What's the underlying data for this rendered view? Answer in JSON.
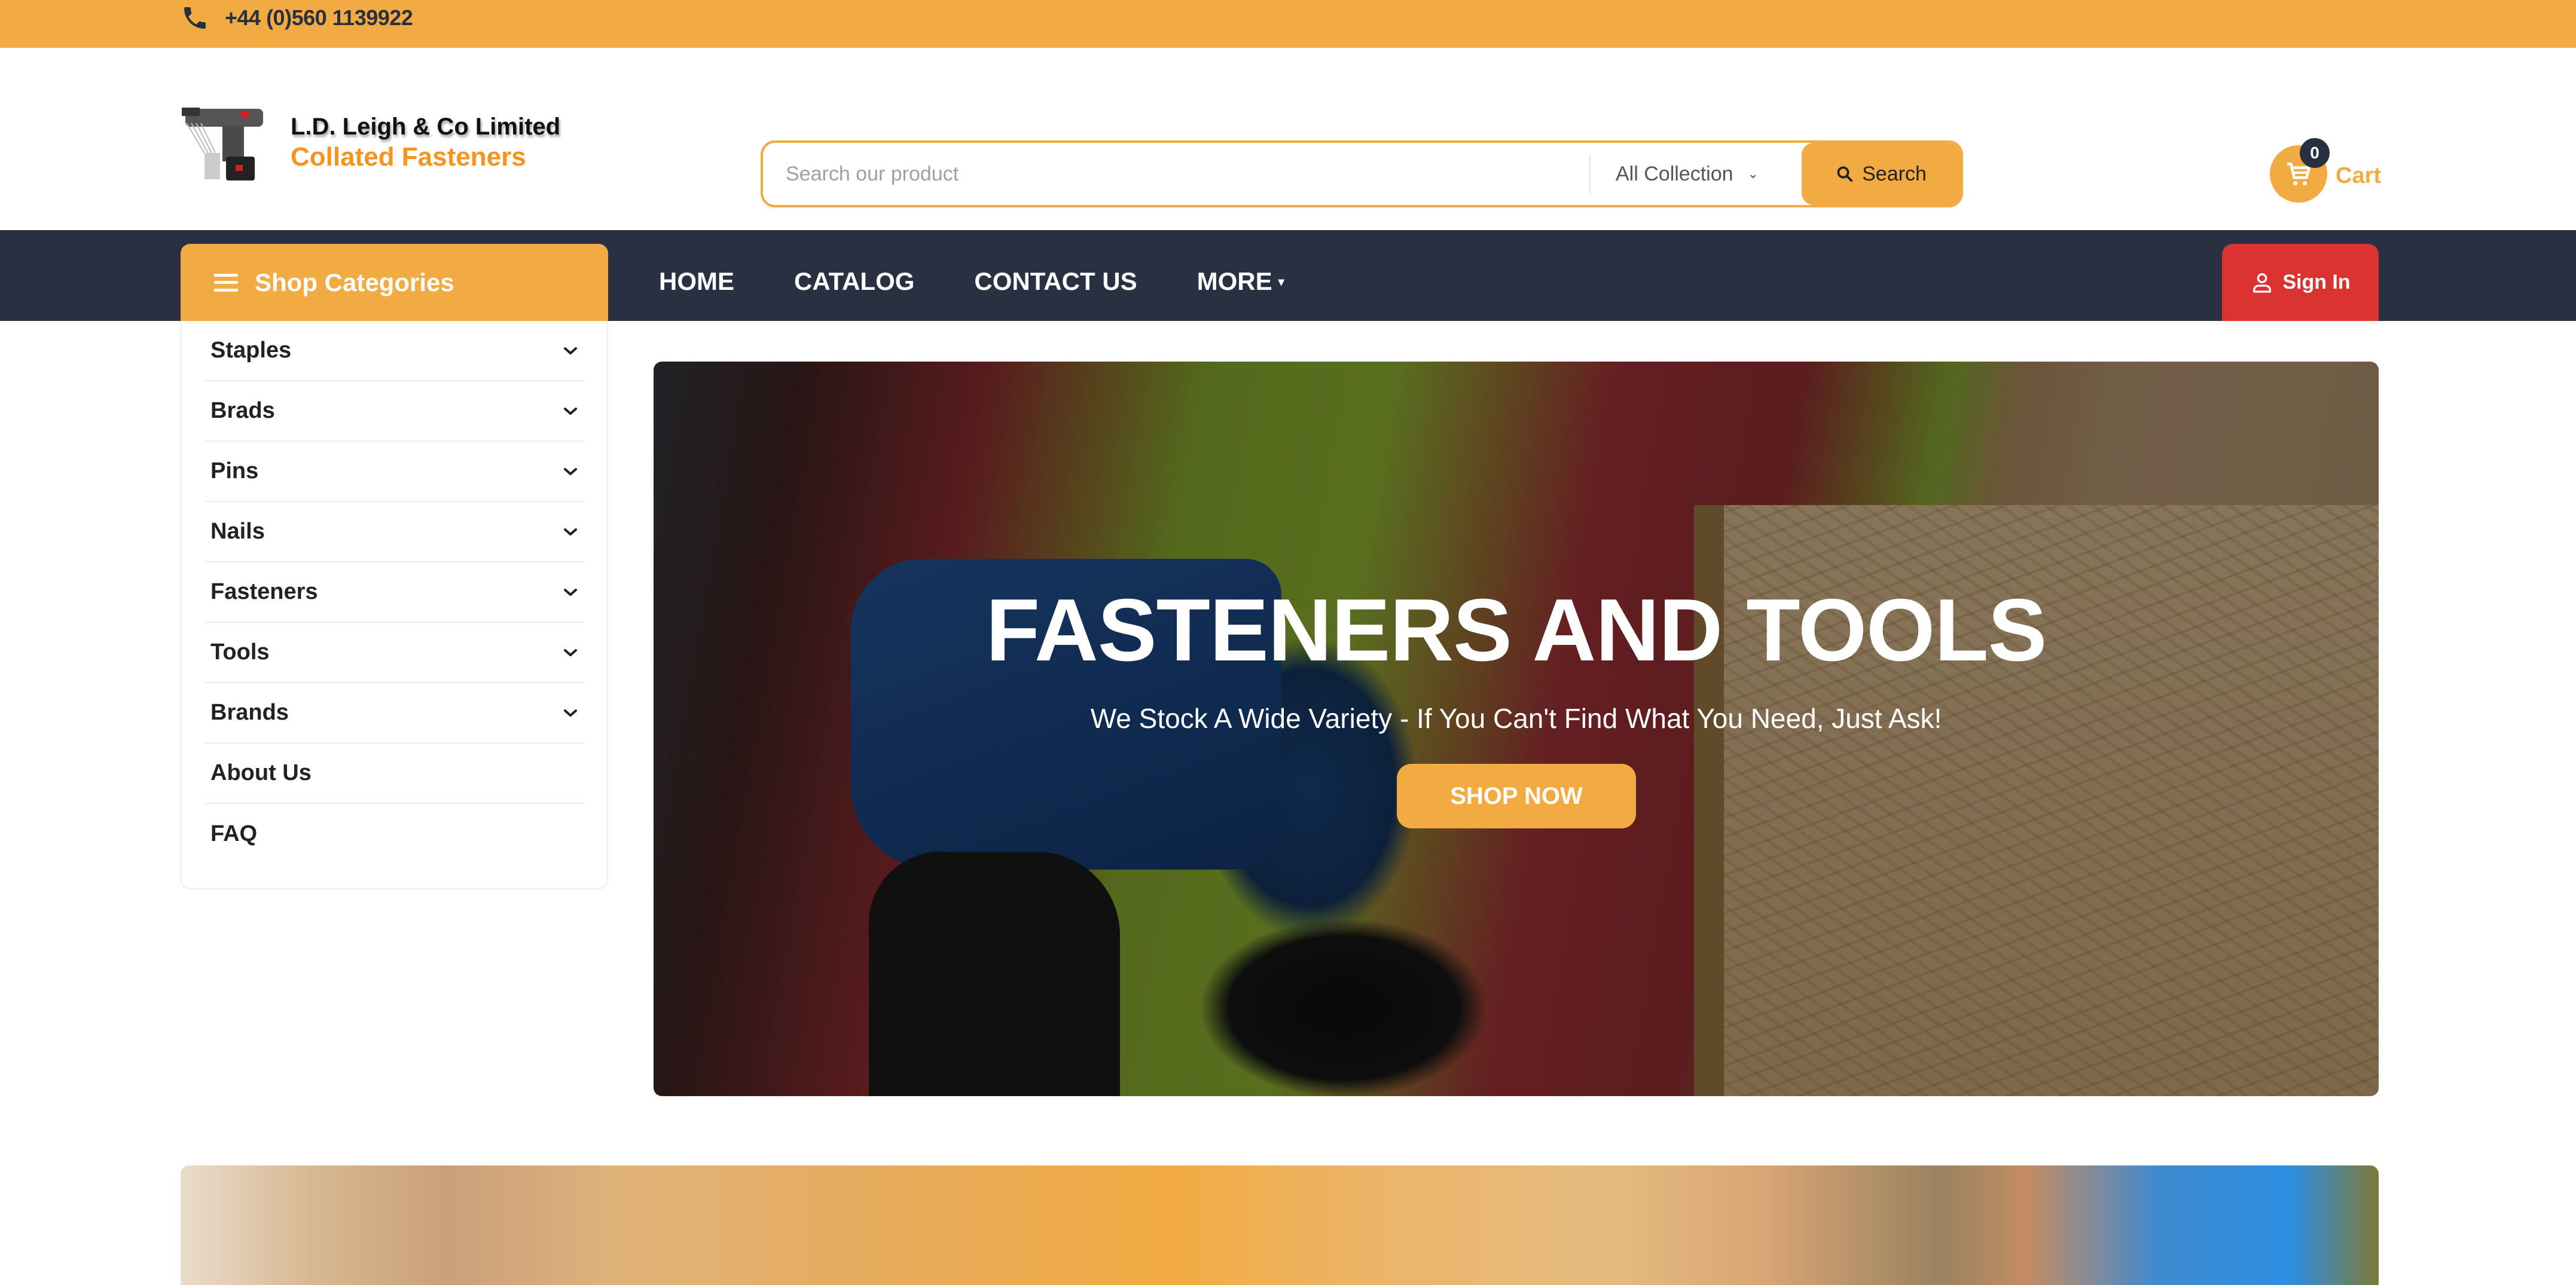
{
  "topbar": {
    "phone_icon": "phone-icon",
    "phone": "+44 (0)560 1139922"
  },
  "header": {
    "logo": {
      "line1": "L.D. Leigh & Co Limited",
      "line2": "Collated Fasteners"
    },
    "search": {
      "placeholder": "Search our product",
      "value": "",
      "collection_selected": "All Collection",
      "button_label": "Search"
    },
    "cart": {
      "count": "0",
      "label": "Cart"
    }
  },
  "nav": {
    "shop_categories_label": "Shop Categories",
    "links": [
      {
        "label": "HOME"
      },
      {
        "label": "CATALOG"
      },
      {
        "label": "CONTACT US"
      },
      {
        "label": "MORE",
        "has_dropdown": true
      }
    ],
    "sign_in_label": "Sign In"
  },
  "sidebar": {
    "items": [
      {
        "label": "Staples",
        "has_dropdown": true
      },
      {
        "label": "Brads",
        "has_dropdown": true
      },
      {
        "label": "Pins",
        "has_dropdown": true
      },
      {
        "label": "Nails",
        "has_dropdown": true
      },
      {
        "label": "Fasteners",
        "has_dropdown": true
      },
      {
        "label": "Tools",
        "has_dropdown": true
      },
      {
        "label": "Brands",
        "has_dropdown": true
      },
      {
        "label": "About Us",
        "has_dropdown": false
      },
      {
        "label": "FAQ",
        "has_dropdown": false
      }
    ]
  },
  "hero": {
    "title": "FASTENERS AND TOOLS",
    "subtitle": "We Stock A Wide Variety - If You Can't Find What You Need, Just Ask!",
    "cta_label": "SHOP NOW"
  },
  "colors": {
    "accent": "#f2ab42",
    "navbar": "#283041",
    "sign_in": "#db3232",
    "logo_orange": "#f7941d"
  }
}
